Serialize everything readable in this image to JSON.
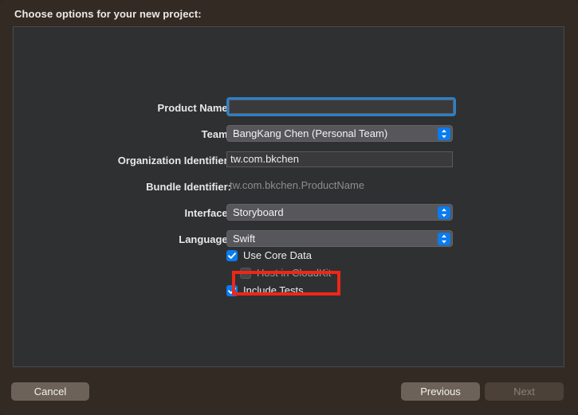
{
  "header": {
    "title": "Choose options for your new project:"
  },
  "form": {
    "fields": [
      {
        "label": "Product Name:",
        "type": "textfield-focused",
        "value": "",
        "placeholder": "",
        "name": "product-name"
      },
      {
        "label": "Team:",
        "type": "popup",
        "value": "BangKang Chen (Personal Team)",
        "name": "team"
      },
      {
        "label": "Organization Identifier:",
        "type": "textfield",
        "value": "tw.com.bkchen",
        "name": "organization-identifier"
      },
      {
        "label": "Bundle Identifier:",
        "type": "static",
        "value": "tw.com.bkchen.ProductName",
        "name": "bundle-identifier"
      },
      {
        "label": "Interface:",
        "type": "popup",
        "value": "Storyboard",
        "name": "interface"
      },
      {
        "label": "Language:",
        "type": "popup",
        "value": "Swift",
        "name": "language"
      }
    ],
    "checkboxes": [
      {
        "label": "Use Core Data",
        "checked": true,
        "enabled": true,
        "indent": false,
        "name": "use-core-data"
      },
      {
        "label": "Host in CloudKit",
        "checked": false,
        "enabled": false,
        "indent": true,
        "name": "host-in-cloudkit"
      },
      {
        "label": "Include Tests",
        "checked": true,
        "enabled": true,
        "indent": false,
        "name": "include-tests"
      }
    ]
  },
  "annotation": {
    "target": "Use Core Data",
    "color": "#ef2617"
  },
  "buttons": {
    "cancel": "Cancel",
    "previous": "Previous",
    "next": "Next",
    "next_enabled": false
  },
  "colors": {
    "window_background": "#332a24",
    "panel_background": "#2f3032",
    "accent_blue": "#0a7bf0",
    "focus_ring": "#2c80c8",
    "annotation_red": "#ef2617",
    "button_face": "#6d6259"
  },
  "icons": {
    "stepper": "chevron-up-down-icon",
    "checkmark": "checkmark-icon"
  }
}
